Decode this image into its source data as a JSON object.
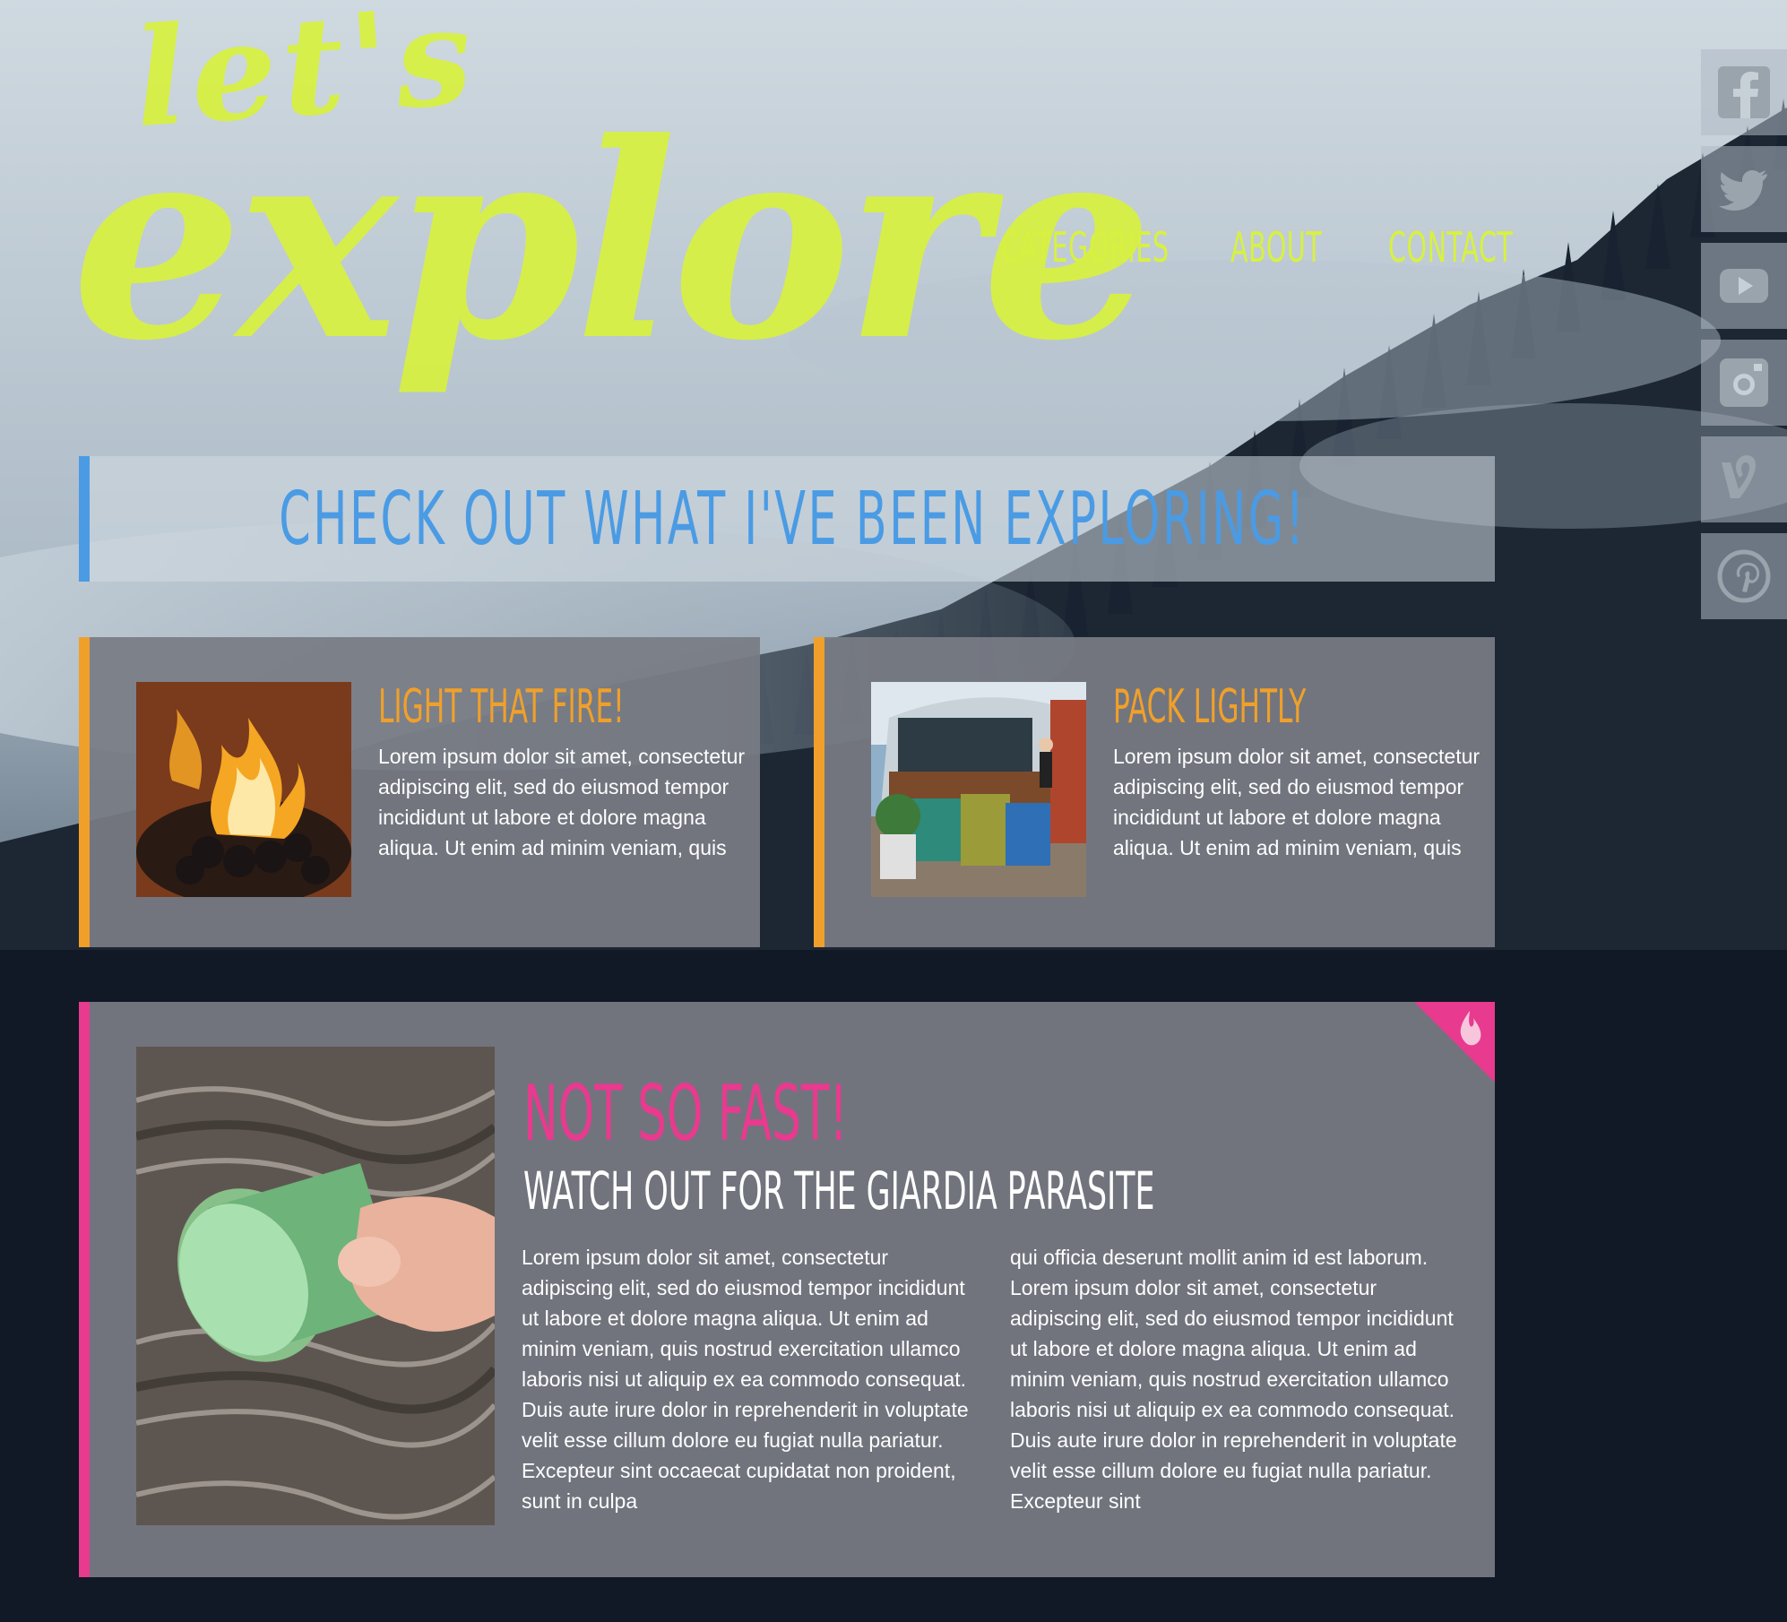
{
  "logo": {
    "top": "let's",
    "main": "explore"
  },
  "nav": {
    "categories": "Categories",
    "about": "About",
    "contact": "Contact"
  },
  "social": [
    "facebook-icon",
    "twitter-icon",
    "youtube-icon",
    "instagram-icon",
    "vine-icon",
    "pinterest-icon"
  ],
  "banner": {
    "title": "Check out what I've been exploring!"
  },
  "cards": [
    {
      "title": "Light that fire!",
      "body": "Lorem ipsum dolor sit amet, consectetur adipiscing elit, sed do eiusmod tempor incididunt ut labore et dolore magna aliqua. Ut enim ad minim veniam, quis"
    },
    {
      "title": "Pack Lightly",
      "body": "Lorem ipsum dolor sit amet, consectetur adipiscing elit, sed do eiusmod tempor incididunt ut labore et dolore magna aliqua. Ut enim ad minim veniam, quis"
    }
  ],
  "feature": {
    "title": "Not so fast!",
    "subtitle": "Watch out for the giardia parasite",
    "col1": "Lorem ipsum dolor sit amet, consectetur adipiscing elit, sed do eiusmod tempor incididunt ut labore et dolore magna aliqua. Ut enim ad minim veniam, quis nostrud exercitation ullamco laboris nisi ut aliquip ex ea commodo consequat. Duis aute irure dolor in reprehenderit in voluptate velit esse cillum dolore eu fugiat nulla pariatur. Excepteur sint occaecat cupidatat non proident, sunt in culpa",
    "col2": "qui officia deserunt mollit anim id est laborum. Lorem ipsum dolor sit amet, consectetur adipiscing elit, sed do eiusmod tempor incididunt ut labore et dolore magna aliqua. Ut enim ad minim veniam, quis nostrud exercitation ullamco laboris nisi ut aliquip ex ea commodo consequat. Duis aute irure dolor in reprehenderit in voluptate velit esse cillum dolore eu fugiat nulla pariatur. Excepteur sint"
  },
  "colors": {
    "lime": "#d8f13f",
    "blue": "#4a9be4",
    "orange": "#f0a02a",
    "pink": "#e83a8e",
    "dark": "#111826"
  }
}
